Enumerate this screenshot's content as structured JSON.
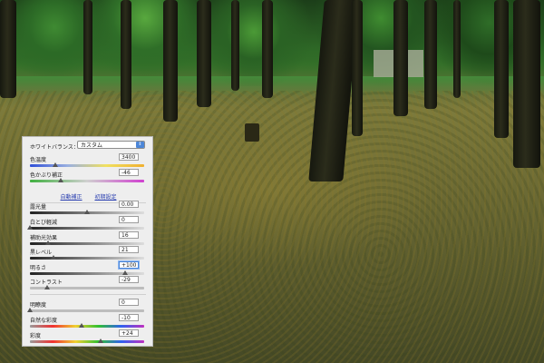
{
  "panel": {
    "white_balance": {
      "label": "ホワイトバランス：",
      "value": "カスタム"
    },
    "rows": [
      {
        "label": "色温度",
        "value": "3400",
        "pos": 0.22
      },
      {
        "label": "色かぶり補正",
        "value": "-46",
        "pos": 0.27
      },
      {
        "label": "露光量",
        "value": "0.00",
        "pos": 0.5
      },
      {
        "label": "白とび軽減",
        "value": "0",
        "pos": 0.0
      },
      {
        "label": "補助光効果",
        "value": "16",
        "pos": 0.16
      },
      {
        "label": "黒レベル",
        "value": "21",
        "pos": 0.21
      },
      {
        "label": "明るさ",
        "value": "+100",
        "pos": 0.83
      },
      {
        "label": "コントラスト",
        "value": "-29",
        "pos": 0.15
      },
      {
        "label": "明瞭度",
        "value": "0",
        "pos": 0.0
      },
      {
        "label": "自然な彩度",
        "value": "-10",
        "pos": 0.45
      },
      {
        "label": "彩度",
        "value": "+24",
        "pos": 0.62
      }
    ],
    "auto_label": "自動補正",
    "default_label": "初期設定"
  }
}
